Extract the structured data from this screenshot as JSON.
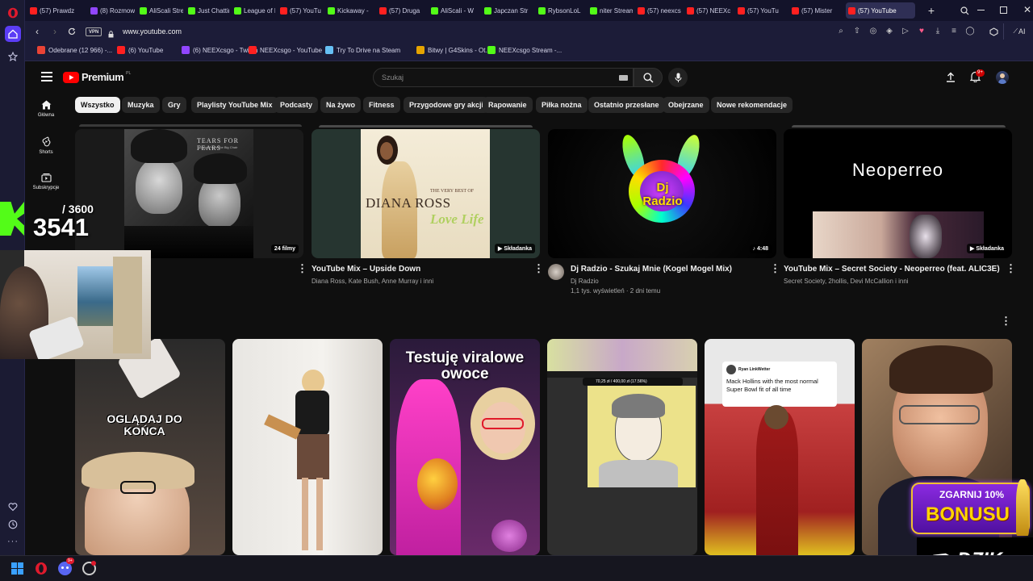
{
  "browser": {
    "tabs": [
      {
        "label": "(57) Prawdz",
        "color": "#ff2020"
      },
      {
        "label": "(8) Rozmow",
        "color": "#9146ff"
      },
      {
        "label": "AliScali Stre",
        "color": "#53fc18"
      },
      {
        "label": "Just Chattin",
        "color": "#53fc18"
      },
      {
        "label": "League of L",
        "color": "#53fc18"
      },
      {
        "label": "(57) YouTu",
        "color": "#ff2020"
      },
      {
        "label": "Kickaway -",
        "color": "#53fc18"
      },
      {
        "label": "(57) Druga",
        "color": "#ff2020"
      },
      {
        "label": "AliScali - W",
        "color": "#53fc18"
      },
      {
        "label": "Japczan Str",
        "color": "#53fc18"
      },
      {
        "label": "RybsonLoL",
        "color": "#53fc18"
      },
      {
        "label": "niter Stream",
        "color": "#53fc18"
      },
      {
        "label": "(57) neexcs",
        "color": "#ff2020"
      },
      {
        "label": "(57) NEEXc",
        "color": "#ff2020"
      },
      {
        "label": "(57) YouTu",
        "color": "#ff2020"
      },
      {
        "label": "(57) Mister",
        "color": "#ff2020"
      },
      {
        "label": "(57) YouTube",
        "color": "#ff2020"
      }
    ],
    "url": "www.youtube.com",
    "vpn_label": "VPN",
    "ai_label": "AI",
    "bookmarks": [
      {
        "label": "Odebrane (12 966) -...",
        "color": "#ea4335"
      },
      {
        "label": "(6) YouTube",
        "color": "#ff2020"
      },
      {
        "label": "(6) NEEXcsgo - Twitch",
        "color": "#9146ff"
      },
      {
        "label": "NEEXcsgo - YouTube",
        "color": "#ff2020"
      },
      {
        "label": "Try To Drive na Steam",
        "color": "#66c0f4"
      },
      {
        "label": "Bitwy | G4Skins - Ot...",
        "color": "#e6a400"
      },
      {
        "label": "NEEXcsgo Stream -...",
        "color": "#53fc18"
      }
    ]
  },
  "youtube": {
    "logo_text": "Premium",
    "logo_region": "PL",
    "search_placeholder": "Szukaj",
    "notif_count": "9+",
    "nav": [
      {
        "label": "Główna",
        "icon": "home-icon"
      },
      {
        "label": "Shorts",
        "icon": "shorts-icon"
      },
      {
        "label": "Subskrypcje",
        "icon": "subscriptions-icon"
      }
    ],
    "chips": [
      "Wszystko",
      "Muzyka",
      "Gry",
      "Playlisty YouTube Mix",
      "Podcasty",
      "Na żywo",
      "Fitness",
      "Przygodowe gry akcji",
      "Rapowanie",
      "Piłka nożna",
      "Ostatnio przesłane",
      "Obejrzane",
      "Nowe rekomendacje"
    ],
    "videos": [
      {
        "badge": "24 filmy",
        "title": "",
        "meta1": "",
        "meta2": "",
        "thumb_text": "TEARS FOR FEARS",
        "thumb_sub": "Songs From The Big Chair"
      },
      {
        "badge": "Składanka",
        "title": "YouTube Mix – Upside Down",
        "meta1": "Diana Ross, Kate Bush, Anne Murray i inni",
        "meta2": "",
        "thumb_text": "DIANA ROSS",
        "thumb_sub": "THE VERY BEST OF",
        "thumb_script": "Love Life"
      },
      {
        "badge": "4:48",
        "title": "Dj Radzio -  Szukaj Mnie (Kogel Mogel Mix)",
        "meta1": "Dj Radzio",
        "meta2": "1,1 tys. wyświetleń · 2 dni temu",
        "thumb_text": "Dj Radzio"
      },
      {
        "badge": "Składanka",
        "title": "YouTube Mix – Secret Society - Neoperreo (feat. ALIC3E)",
        "meta1": "Secret Society, 2hollis, Devi McCallion i inni",
        "meta2": "",
        "thumb_text": "Neoperreo"
      }
    ],
    "shorts_thumb_texts": {
      "ogladaj": "OGLĄDAJ DO KOŃCA",
      "testuje": "Testuję viralowe owoce",
      "tweet_name": "Ryan LinkWetter",
      "tweet_text": "Mack Hollins with the most normal Super Bowl fit of all time",
      "drawing_bar": "70,25 zł / 400,00 zł (17.56%)"
    }
  },
  "stream_overlay": {
    "counter_current": "3541",
    "counter_total": "/ 3600",
    "promo_line1": "ZGARNIJ 10%",
    "promo_line2": "BONUSU",
    "brand": "DZIK"
  },
  "taskbar": {
    "discord_badge": "9+"
  }
}
